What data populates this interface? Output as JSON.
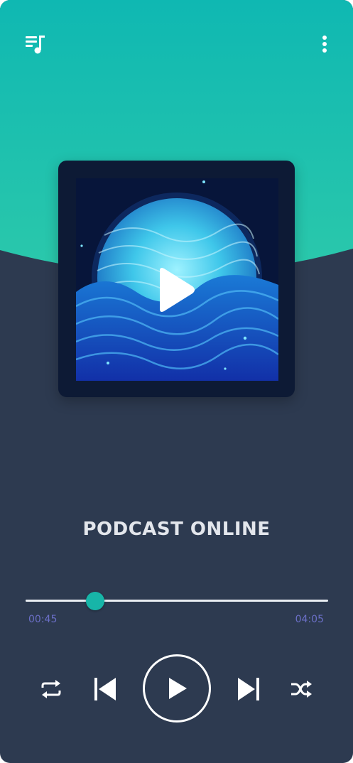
{
  "app": {
    "colors": {
      "header_top": "#0fb8b2",
      "header_bottom": "#26c7ad",
      "background": "#2d3a50",
      "accent": "#17b5a8",
      "time_text": "#6b6fc7",
      "title_text": "#e3e6ec"
    }
  },
  "header": {
    "left_icon": "playlist-music-icon",
    "right_icon": "more-vertical-icon"
  },
  "cover": {
    "art": "ocean-waves-artwork",
    "overlay_icon": "play-icon"
  },
  "track": {
    "title": "PODCAST ONLINE"
  },
  "progress": {
    "elapsed": "00:45",
    "total": "04:05",
    "fraction": 0.23
  },
  "controls": {
    "repeat_icon": "repeat-icon",
    "previous_icon": "skip-previous-icon",
    "play_icon": "play-icon",
    "next_icon": "skip-next-icon",
    "shuffle_icon": "shuffle-icon"
  }
}
